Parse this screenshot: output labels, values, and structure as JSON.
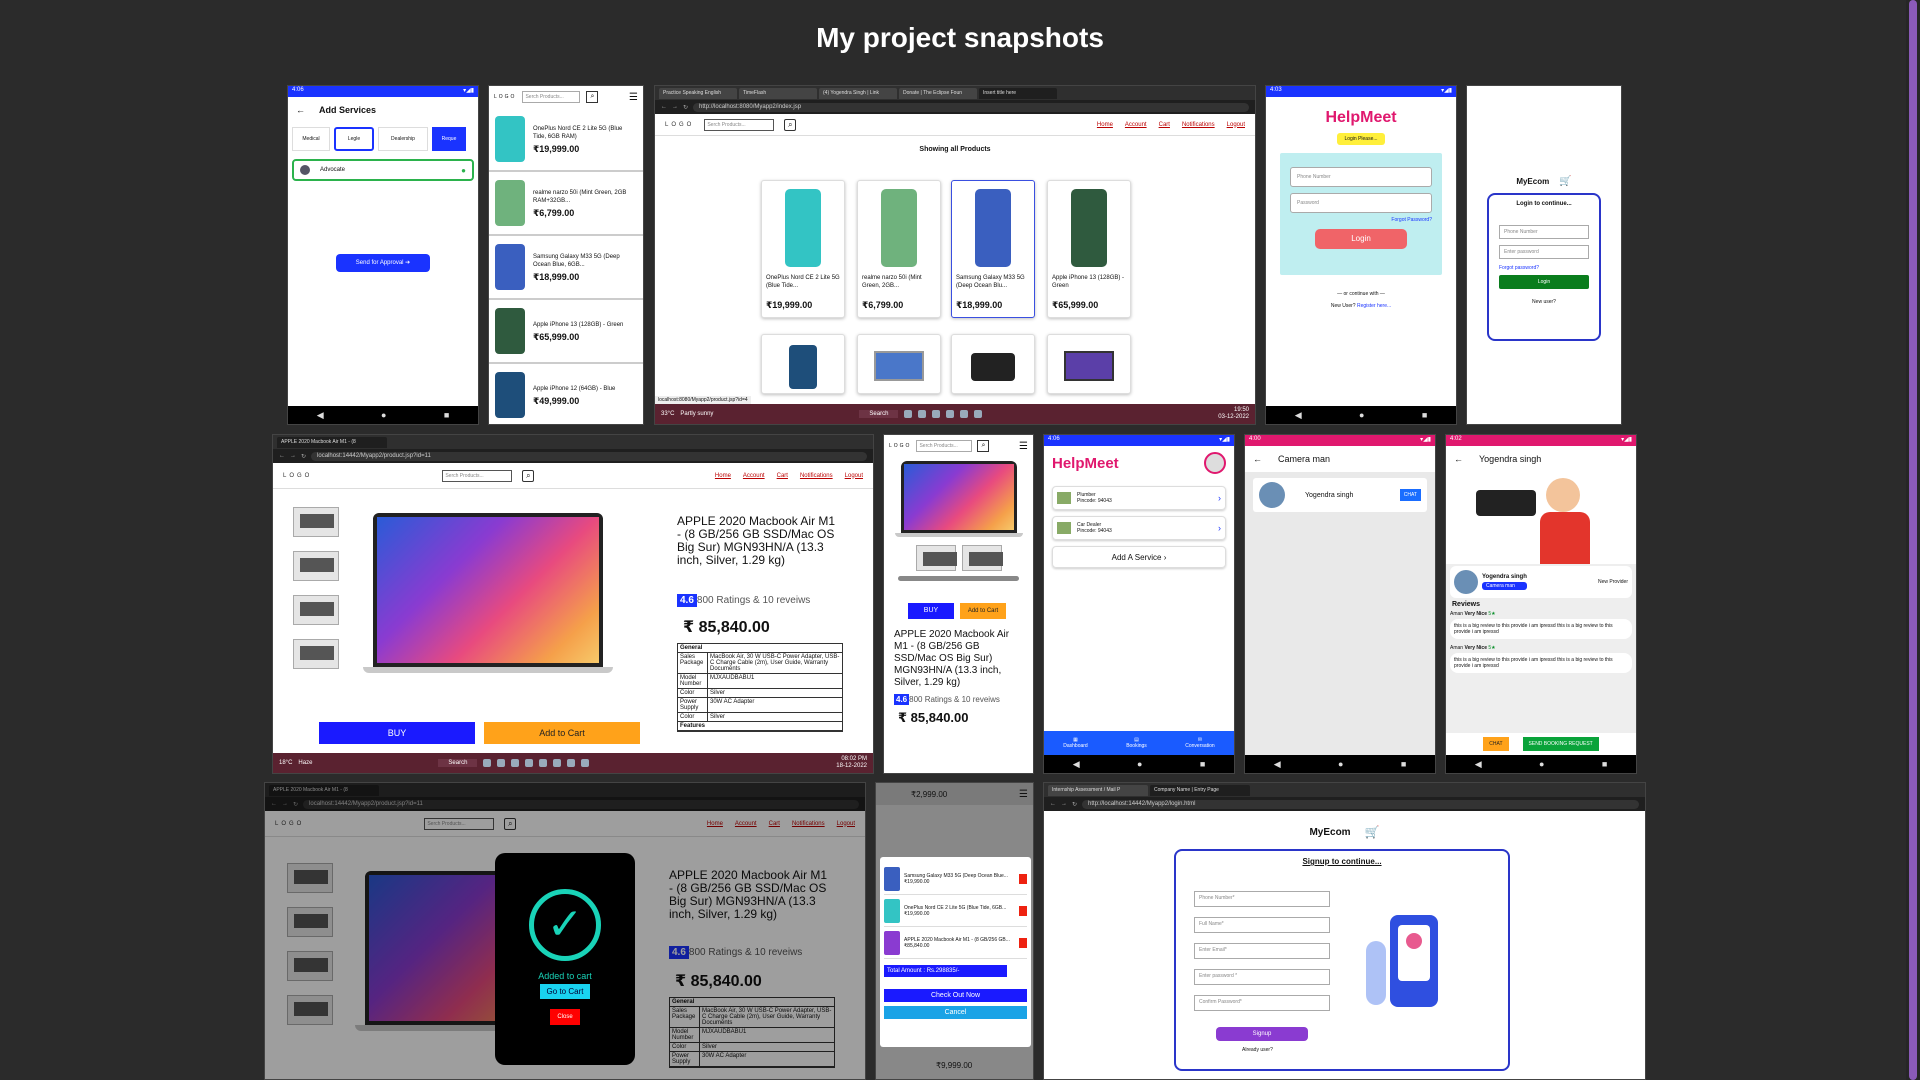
{
  "page": {
    "title": "My project snapshots"
  },
  "common": {
    "logo": "LOGO",
    "search_placeholder": "Serch Products...",
    "nav": [
      "Home",
      "Account",
      "Cart",
      "Notifications",
      "Logout"
    ]
  },
  "s1": {
    "time": "4:06",
    "title": "Add Services",
    "cats": [
      "Medical",
      "Legle",
      "Dealership",
      "Reque"
    ],
    "item": "Advocate",
    "button": "Send for Approval"
  },
  "s2": {
    "items": [
      {
        "name": "OnePlus Nord CE 2 Lite 5G (Blue Tide, 6GB RAM)",
        "price": "₹19,999.00",
        "color": "#33c4c4"
      },
      {
        "name": "realme narzo 50i (Mint Green, 2GB RAM+32GB...",
        "price": "₹6,799.00",
        "color": "#6fb27d"
      },
      {
        "name": "Samsung Galaxy M33 5G (Deep Ocean Blue, 6GB...",
        "price": "₹18,999.00",
        "color": "#3a5fbf"
      },
      {
        "name": "Apple iPhone 13 (128GB) - Green",
        "price": "₹65,999.00",
        "color": "#2f5a3e"
      },
      {
        "name": "Apple iPhone 12 (64GB) - Blue",
        "price": "₹49,999.00",
        "color": "#1e4e7a"
      }
    ]
  },
  "s3": {
    "tabs": [
      "Practice Speaking English",
      "TimeFlash",
      "(4) Yogendra Singh | Link",
      "Donate | The Eclipse Foun",
      "Insert title here"
    ],
    "url": "http://localhost:8080/Myapp2/index.jsp",
    "heading": "Showing all Products",
    "products": [
      {
        "name": "OnePlus Nord CE 2 Lite 5G (Blue Tide...",
        "price": "₹19,999.00",
        "color": "#33c4c4"
      },
      {
        "name": "realme narzo 50i (Mint Green, 2GB...",
        "price": "₹6,799.00",
        "color": "#6fb27d"
      },
      {
        "name": "Samsung Galaxy M33 5G (Deep Ocean Blu...",
        "price": "₹18,999.00",
        "color": "#3a5fbf"
      },
      {
        "name": "Apple iPhone 13 (128GB) - Green",
        "price": "₹65,999.00",
        "color": "#2f5a3e"
      }
    ],
    "status_url": "localhost:8080/Myapp2/product.jsp?id=4",
    "weather": "33°C",
    "weather_desc": "Partly sunny",
    "search": "Search",
    "time": "19:50",
    "date": "03-12-2022"
  },
  "s4": {
    "time": "4:03",
    "brand": "HelpMeet",
    "login_tag": "Login Please...",
    "phone_ph": "Phone Number",
    "password_ph": "Password",
    "forgot": "Forgot Password?",
    "login": "Login",
    "continue": "— or continue with —",
    "new_user": "New User?",
    "register": "Register here..."
  },
  "s5": {
    "brand": "MyEcom",
    "subtitle": "Login to continue...",
    "phone_ph": "Phone Number",
    "password_ph": "Enter password",
    "forgot": "Forgot password?",
    "login": "Login",
    "new_user": "New user?"
  },
  "s6": {
    "tab": "APPLE 2020 Macbook Air M1 - (8",
    "url": "localhost:14442/Myapp2/product.jsp?id=11",
    "title": "APPLE 2020 Macbook Air M1 - (8 GB/256 GB SSD/Mac OS Big Sur) MGN93HN/A (13.3 inch, Silver, 1.29 kg)",
    "rating": "4.6",
    "reviews": "800 Ratings & 10 reveiws",
    "price": "₹ 85,840.00",
    "spec_header": "General",
    "specs": [
      {
        "k": "Sales Package",
        "v": "MacBook Air, 30 W USB-C Power Adapter, USB-C Charge Cable (2m), User Guide, Warranty Documents"
      },
      {
        "k": "Model Number",
        "v": "MJXAUDBABU1"
      },
      {
        "k": "Color",
        "v": "Silver"
      },
      {
        "k": "Power Supply",
        "v": "30W AC Adapter"
      },
      {
        "k": "Color",
        "v": "Silver"
      }
    ],
    "features": "Features",
    "buy": "BUY",
    "cart": "Add to Cart",
    "weather": "18°C",
    "weather_desc": "Haze",
    "search": "Search",
    "time": "08:02 PM",
    "date": "18-12-2022"
  },
  "s7": {
    "buy": "BUY",
    "cart": "Add to Cart",
    "title": "APPLE 2020 Macbook Air M1 - (8 GB/256 GB SSD/Mac OS Big Sur) MGN93HN/A (13.3 inch, Silver, 1.29 kg)",
    "rating": "4.6",
    "reviews": "800 Ratings & 10 reveiws",
    "price": "₹ 85,840.00"
  },
  "s8": {
    "time": "4:06",
    "brand": "HelpMeet",
    "services": [
      {
        "name": "Plumber",
        "pin": "Pincode: 94043"
      },
      {
        "name": "Car Dealer",
        "pin": "Pincode: 94043"
      }
    ],
    "add": "Add A Service",
    "tabs": [
      "Dashboard",
      "Bookings",
      "Conversation"
    ]
  },
  "s9": {
    "time": "4:00",
    "title": "Camera man",
    "person": "Yogendra singh",
    "chat": "CHAT"
  },
  "s10": {
    "time": "4:02",
    "title": "Yogendra singh",
    "name": "Yogendra singh",
    "badge": "Camera man",
    "new_provider": "New Provider",
    "reviews_label": "Reviews",
    "reviews": [
      {
        "user": "Aman",
        "rate": "Very Nice",
        "stars": "5★",
        "text": "this is a big review to this provide i am ipressd this is a big review to this provide i am ipressd"
      },
      {
        "user": "Aman",
        "rate": "Very Nice",
        "stars": "5★",
        "text": "this is a big review to this provide i am ipressd this is a big review to this provide i am ipressd"
      }
    ],
    "chat": "CHAT",
    "book": "SEND BOOKING REQUEST"
  },
  "s11": {
    "tab": "APPLE 2020 Macbook Air M1 - (8",
    "url": "localhost:14442/Myapp2/product.jsp?id=11",
    "title": "APPLE 2020 Macbook Air M1 - (8 GB/256 GB SSD/Mac OS Big Sur) MGN93HN/A (13.3 inch, Silver, 1.29 kg)",
    "rating": "4.6",
    "reviews": "800 Ratings & 10 reveiws",
    "price": "₹ 85,840.00",
    "added": "Added to cart",
    "go": "Go to Cart",
    "close": "Close",
    "specs": [
      {
        "k": "Sales Package",
        "v": "MacBook Air, 30 W USB-C Power Adapter, USB-C Charge Cable (2m), User Guide, Warranty Documents"
      },
      {
        "k": "Model Number",
        "v": "MJXAUDBABU1"
      },
      {
        "k": "Color",
        "v": "Silver"
      },
      {
        "k": "Power Supply",
        "v": "30W AC Adapter"
      }
    ],
    "spec_header": "General"
  },
  "s12": {
    "top_price": "₹2,999.00",
    "items": [
      {
        "name": "Samsung Galaxy M33 5G (Deep Ocean Blue...",
        "price": "₹19,990.00",
        "color": "#3a5fbf"
      },
      {
        "name": "OnePlus Nord CE 2 Lite 5G (Blue Tide, 6GB...",
        "price": "₹19,990.00",
        "color": "#33c4c4"
      },
      {
        "name": "APPLE 2020 Macbook Air M1 - (8 GB/256 GB...",
        "price": "₹85,840.00",
        "color": "#8a3bd1"
      }
    ],
    "total": "Total Amount : Rs.298835/-",
    "checkout": "Check Out Now",
    "cancel": "Cancel",
    "bottom_price": "₹9,999.00"
  },
  "s13": {
    "tabs": [
      "Internship Assessment / Mail P",
      "Company Name | Entry Page"
    ],
    "url": "http://localhost:14442/Myapp2/login.html",
    "brand": "MyEcom",
    "subtitle": "Signup to continue...",
    "fields": [
      "Phone Number*",
      "Full Name*",
      "Enter Email*",
      "Enter password *",
      "Confirm Password*"
    ],
    "signup": "Signup",
    "already": "Already user?"
  }
}
